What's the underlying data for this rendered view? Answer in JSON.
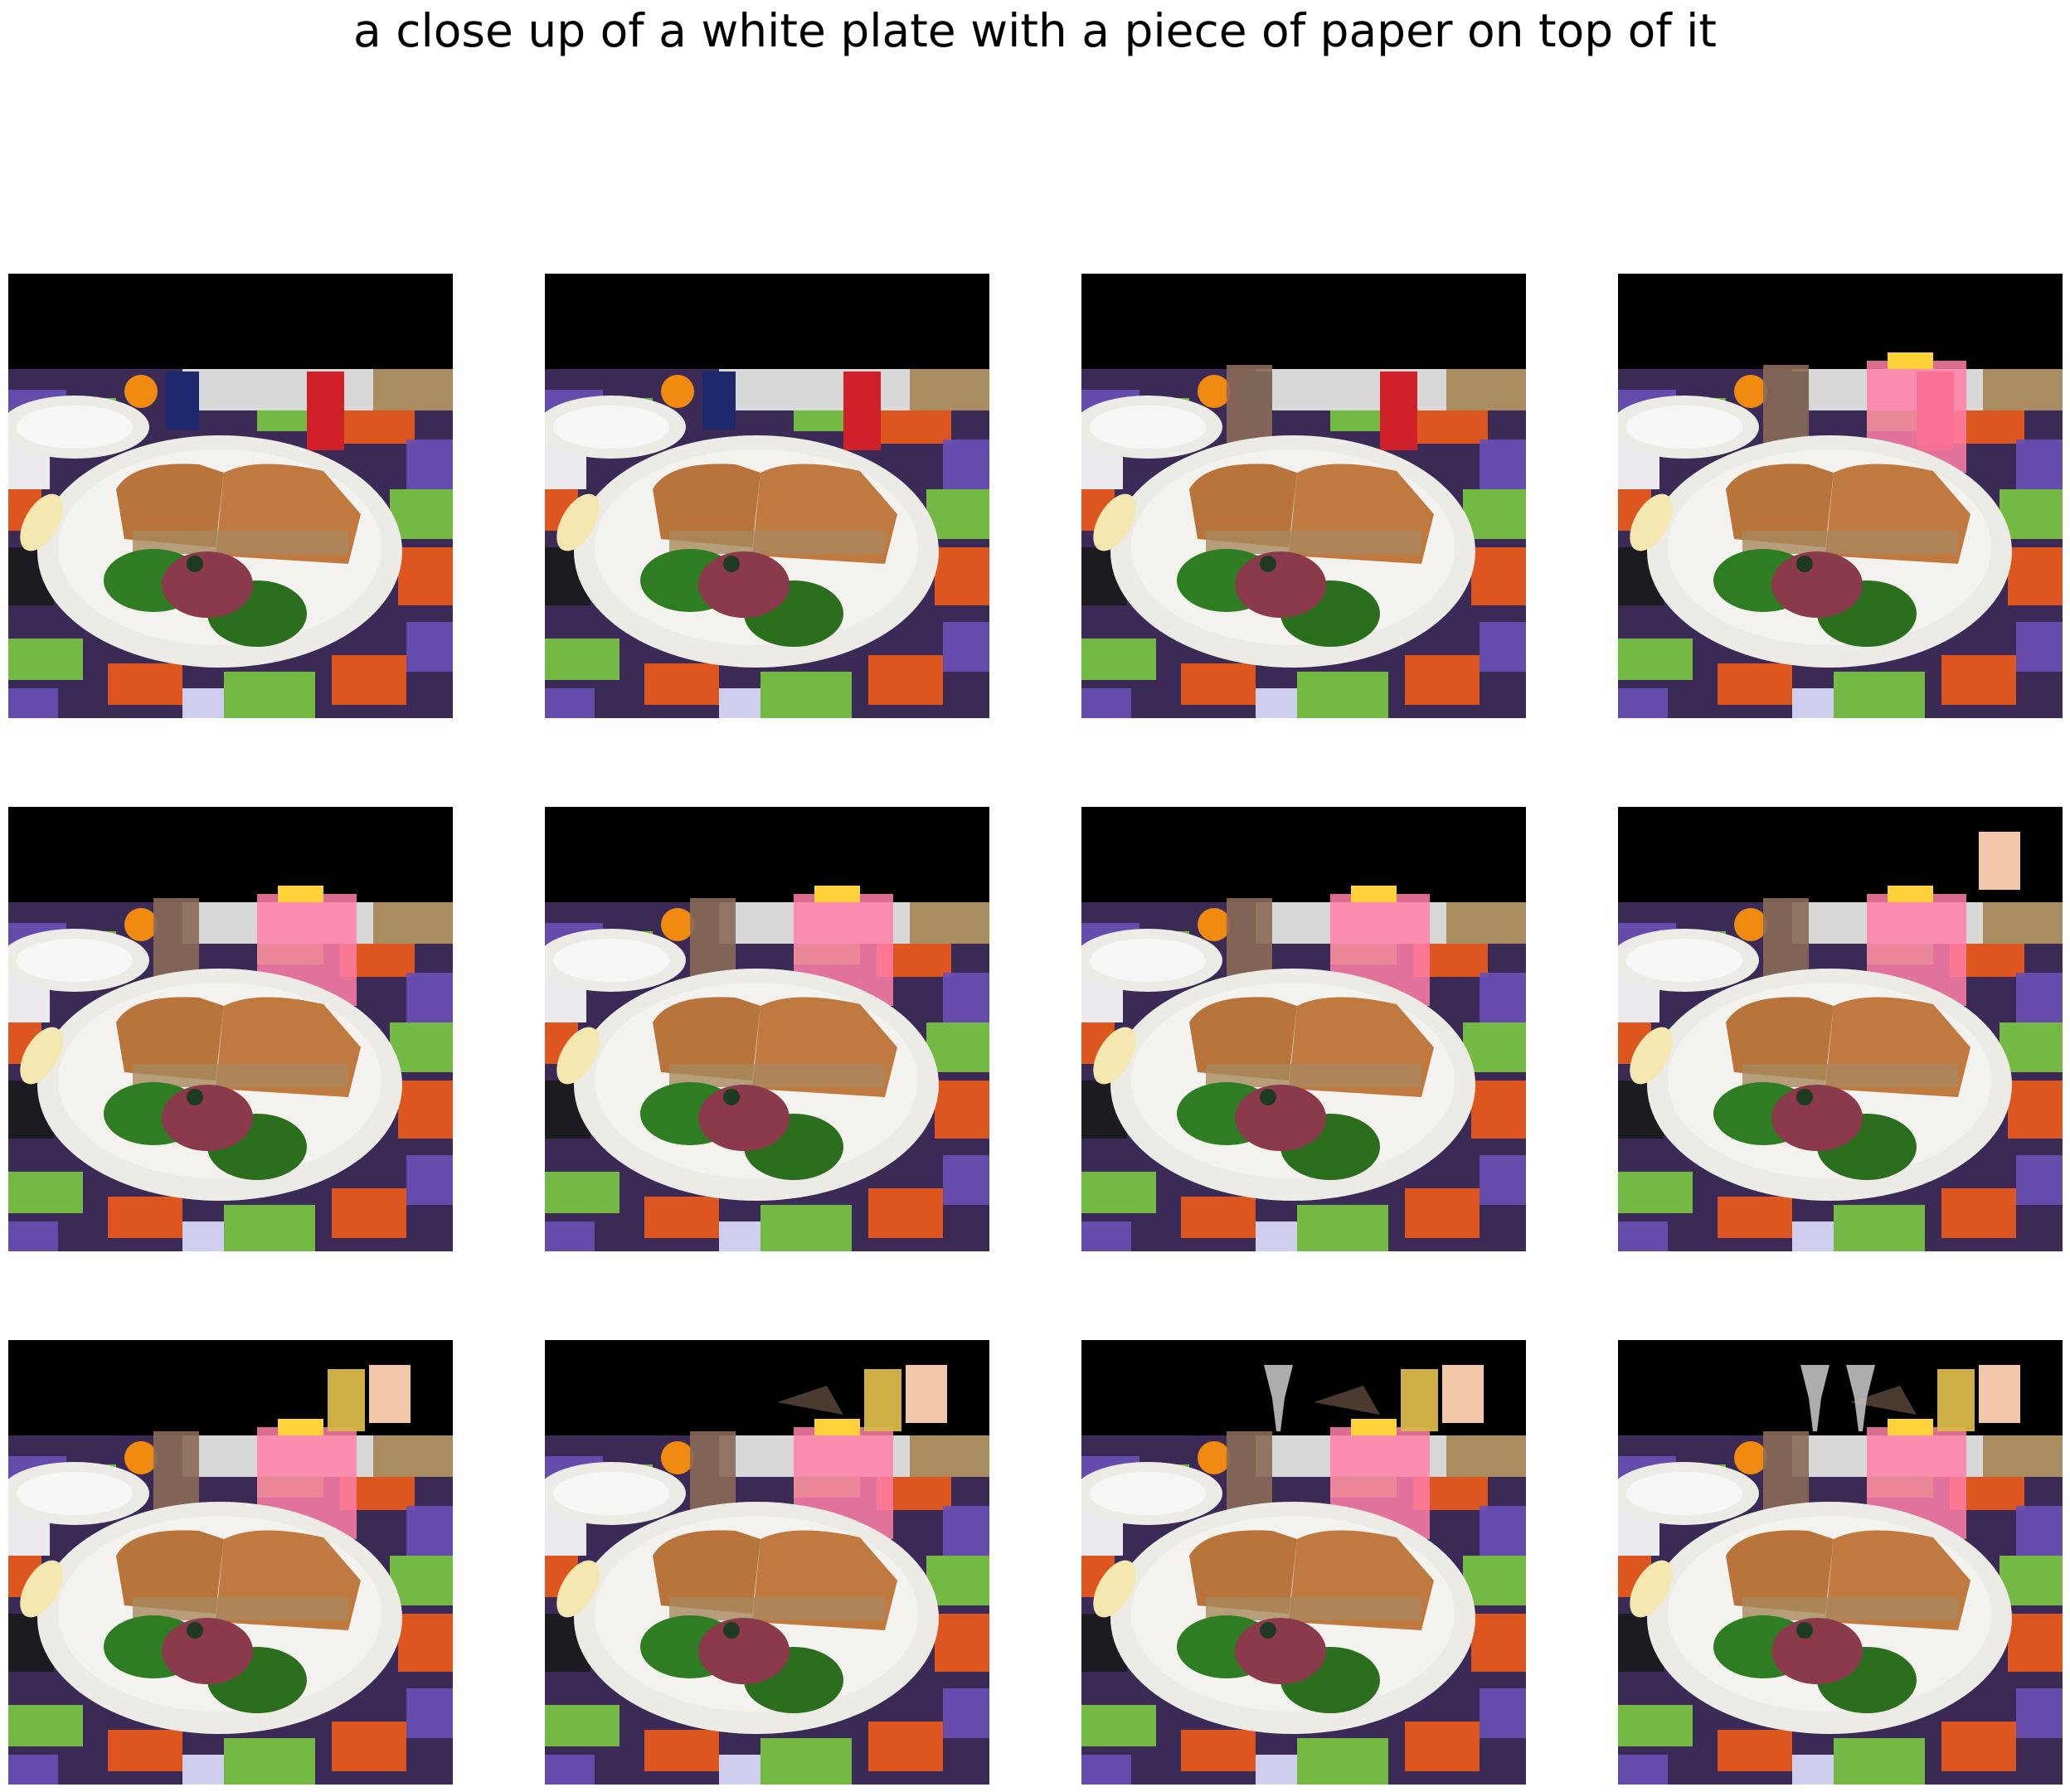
{
  "title": "a close up of a white plate with a piece of paper on top of it",
  "grid": {
    "rows": 3,
    "columns": 4
  },
  "panels": [
    {
      "index": 1,
      "cans_visible": true,
      "sunset_glow": false,
      "tall_glass": false,
      "corner_photo": false,
      "beer_glass": false,
      "wine_glasses": 0,
      "cake_on_table": false
    },
    {
      "index": 2,
      "cans_visible": true,
      "sunset_glow": false,
      "tall_glass": false,
      "corner_photo": false,
      "beer_glass": false,
      "wine_glasses": 0,
      "cake_on_table": false
    },
    {
      "index": 3,
      "cans_visible": true,
      "sunset_glow": false,
      "tall_glass": true,
      "corner_photo": false,
      "beer_glass": false,
      "wine_glasses": 0,
      "cake_on_table": false
    },
    {
      "index": 4,
      "cans_visible": true,
      "sunset_glow": true,
      "tall_glass": true,
      "corner_photo": false,
      "beer_glass": false,
      "wine_glasses": 0,
      "cake_on_table": false
    },
    {
      "index": 5,
      "cans_visible": false,
      "sunset_glow": true,
      "tall_glass": true,
      "corner_photo": false,
      "beer_glass": false,
      "wine_glasses": 0,
      "cake_on_table": false
    },
    {
      "index": 6,
      "cans_visible": false,
      "sunset_glow": true,
      "tall_glass": true,
      "corner_photo": false,
      "beer_glass": false,
      "wine_glasses": 0,
      "cake_on_table": false
    },
    {
      "index": 7,
      "cans_visible": false,
      "sunset_glow": true,
      "tall_glass": true,
      "corner_photo": false,
      "beer_glass": false,
      "wine_glasses": 0,
      "cake_on_table": false
    },
    {
      "index": 8,
      "cans_visible": false,
      "sunset_glow": true,
      "tall_glass": true,
      "corner_photo": true,
      "beer_glass": false,
      "wine_glasses": 0,
      "cake_on_table": false
    },
    {
      "index": 9,
      "cans_visible": false,
      "sunset_glow": true,
      "tall_glass": true,
      "corner_photo": true,
      "beer_glass": true,
      "wine_glasses": 0,
      "cake_on_table": false
    },
    {
      "index": 10,
      "cans_visible": false,
      "sunset_glow": true,
      "tall_glass": true,
      "corner_photo": true,
      "beer_glass": true,
      "wine_glasses": 0,
      "cake_on_table": true
    },
    {
      "index": 11,
      "cans_visible": false,
      "sunset_glow": true,
      "tall_glass": true,
      "corner_photo": true,
      "beer_glass": true,
      "wine_glasses": 1,
      "cake_on_table": true
    },
    {
      "index": 12,
      "cans_visible": false,
      "sunset_glow": true,
      "tall_glass": true,
      "corner_photo": true,
      "beer_glass": true,
      "wine_glasses": 2,
      "cake_on_table": true
    }
  ],
  "colors": {
    "background": "#ffffff",
    "panel_black": "#000000",
    "plate": "#ecebe6",
    "toast": "#b8743a",
    "spinach": "#2f7d22",
    "salami": "#8a3a4a",
    "tablecloth_green": "#7ac943",
    "tablecloth_orange": "#f05a1a",
    "tablecloth_purple": "#6a4fb5",
    "glow": "#ff7fa8"
  }
}
